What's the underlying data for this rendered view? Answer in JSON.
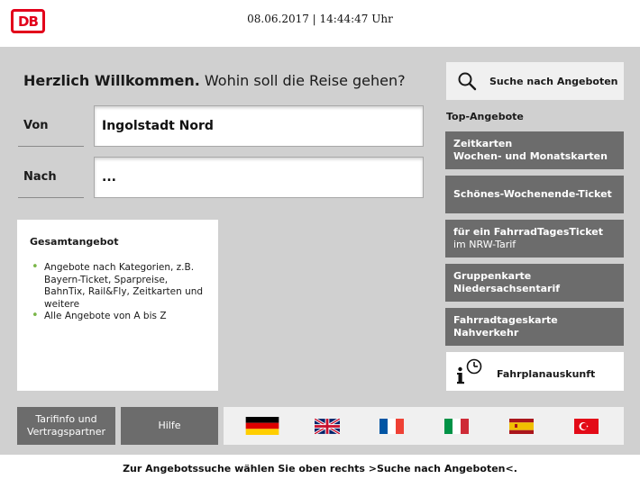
{
  "header": {
    "logo_text": "DB",
    "datetime": "08.06.2017 | 14:44:47 Uhr"
  },
  "headline": {
    "bold": "Herzlich Willkommen.",
    "normal": "Wohin soll die Reise gehen?"
  },
  "route": {
    "von_label": "Von",
    "von_value": "Ingolstadt Nord",
    "nach_label": "Nach",
    "nach_value": "..."
  },
  "gesamtangebot": {
    "title": "Gesamtangebot",
    "items": [
      "Angebote nach Kategorien, z.B. Bayern-Ticket, Sparpreise, BahnTix, Rail&Fly, Zeitkarten und weitere",
      "Alle Angebote von A bis Z"
    ]
  },
  "search": {
    "label": "Suche nach Angeboten",
    "icon": "search-icon"
  },
  "top_offers": {
    "title": "Top-Angebote",
    "items": [
      {
        "line1": "Zeitkarten",
        "line2": "Wochen- und Monatskarten"
      },
      {
        "line1": "Schönes-Wochenende-Ticket",
        "line2": ""
      },
      {
        "line1": "für ein FahrradTagesTicket",
        "line2": "im NRW-Tarif"
      },
      {
        "line1": "Gruppenkarte",
        "line2": "Niedersachsentarif"
      },
      {
        "line1": "Fahrradtageskarte Nahverkehr",
        "line2": ""
      }
    ]
  },
  "fahrplan": {
    "label": "Fahrplanauskunft",
    "icon": "info-clock-icon"
  },
  "bottom": {
    "tarif_line1": "Tarifinfo und",
    "tarif_line2": "Vertragspartner",
    "hilfe": "Hilfe"
  },
  "languages": [
    "german-flag-icon",
    "uk-flag-icon",
    "french-flag-icon",
    "italian-flag-icon",
    "spanish-flag-icon",
    "turkish-flag-icon"
  ],
  "footer": {
    "message": "Zur Angebotssuche wählen Sie oben rechts >Suche nach Angeboten<."
  },
  "colors": {
    "db_red": "#e2001a",
    "panel_grey": "#d0d0d0",
    "button_grey": "#6c6c6c",
    "bullet_green": "#7ab648"
  }
}
